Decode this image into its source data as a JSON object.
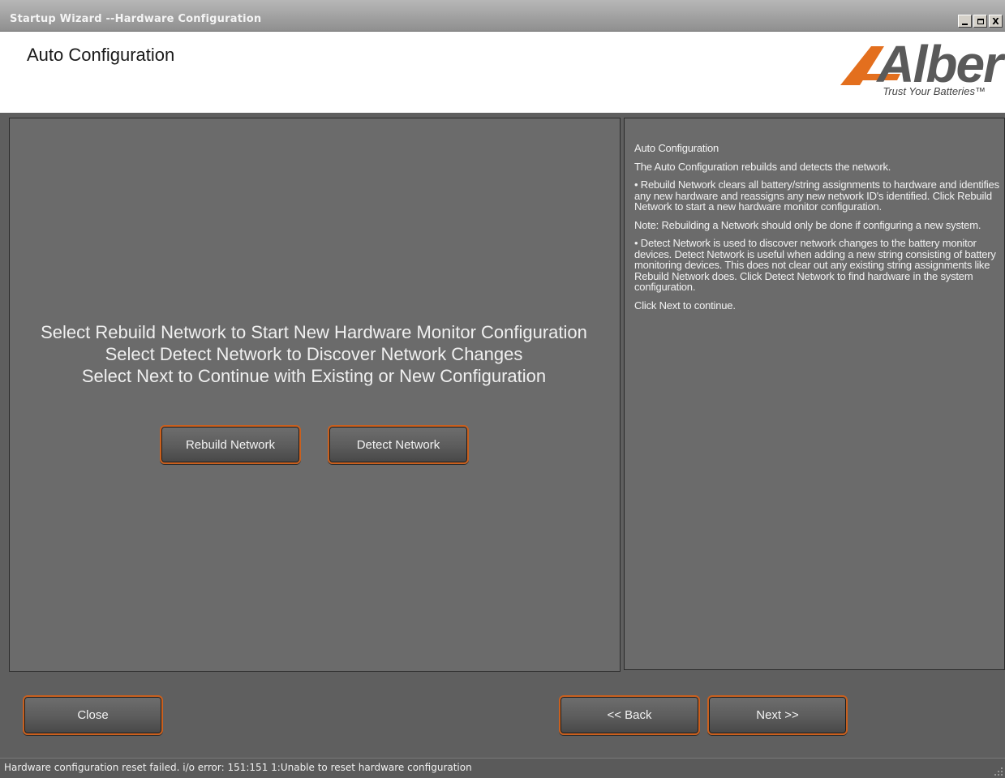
{
  "window": {
    "title": "Startup Wizard --Hardware Configuration",
    "minimize_label": "_",
    "maximize_label": "□",
    "close_label": "X"
  },
  "header": {
    "title": "Auto Configuration",
    "logo": {
      "brand": "Alber",
      "tagline": "Trust Your Batteries™"
    }
  },
  "main": {
    "instructions": [
      "Select Rebuild Network to Start New Hardware Monitor Configuration",
      "Select Detect Network to Discover Network Changes",
      "Select Next to Continue with Existing or New Configuration"
    ],
    "rebuild_button": "Rebuild Network",
    "detect_button": "Detect Network"
  },
  "help": {
    "heading": "Auto Configuration",
    "intro": "The Auto Configuration rebuilds and detects the network.",
    "rebuild": "•  Rebuild Network clears all battery/string assignments to hardware and identifies any new hardware and reassigns any new network ID's identified. Click Rebuild Network to start a new hardware monitor configuration.",
    "note": "Note: Rebuilding a Network should only be done if configuring a new system.",
    "detect": "•  Detect Network is used to discover network changes to the battery monitor devices. Detect Network is useful when adding a new string consisting of battery monitoring devices. This does not clear out any existing string assignments like Rebuild Network does. Click Detect Network to find hardware in the system configuration.",
    "continue": "Click Next to continue."
  },
  "footer": {
    "close_button": "Close",
    "back_button": "<< Back",
    "next_button": "Next >>"
  },
  "status": {
    "text": "Hardware configuration reset failed. i/o error: 151:151 1:Unable to reset hardware configuration"
  },
  "colors": {
    "accent": "#c9601f",
    "panel": "#6b6b6b",
    "background": "#5f5f5f"
  }
}
